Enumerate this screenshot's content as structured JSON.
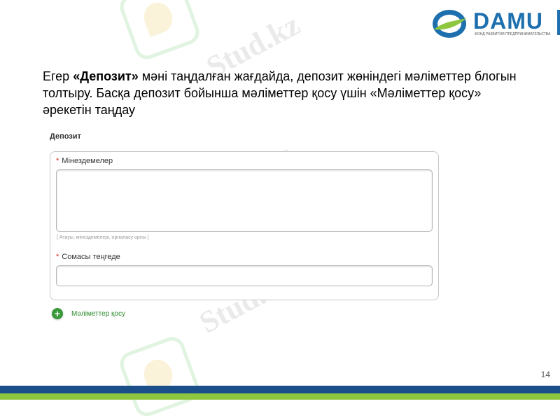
{
  "watermark": "Stud.kz",
  "brand": {
    "logo_text": "DAMU",
    "logo_subtitle": "ФОНД РАЗВИТИЯ ПРЕДПРИНИМАТЕЛЬСТВА",
    "colors": {
      "blue": "#1d6fae",
      "green": "#8ec63f",
      "footer_blue": "#1b4f8a"
    }
  },
  "instruction": {
    "prefix": "Егер ",
    "bold": "«Депозит»",
    "rest": " мәні таңдалған жағдайда, депозит жөніндегі мәліметтер блогын толтыру. Басқа депозит бойынша мәліметтер қосу үшін «Мәліметтер қосу» әрекетін таңдау"
  },
  "form": {
    "section_title": "Депозит",
    "required_mark": "*",
    "characteristics_label": "Мінездемелер",
    "characteristics_value": "",
    "characteristics_hint": "[ Атауы, мінездемелері, орналасу орны ]",
    "amount_label": "Сомасы теңгеде",
    "amount_value": "",
    "add_button_label": "Мәліметтер қосу",
    "add_icon": "plus-circle-icon"
  },
  "page_number": "14"
}
